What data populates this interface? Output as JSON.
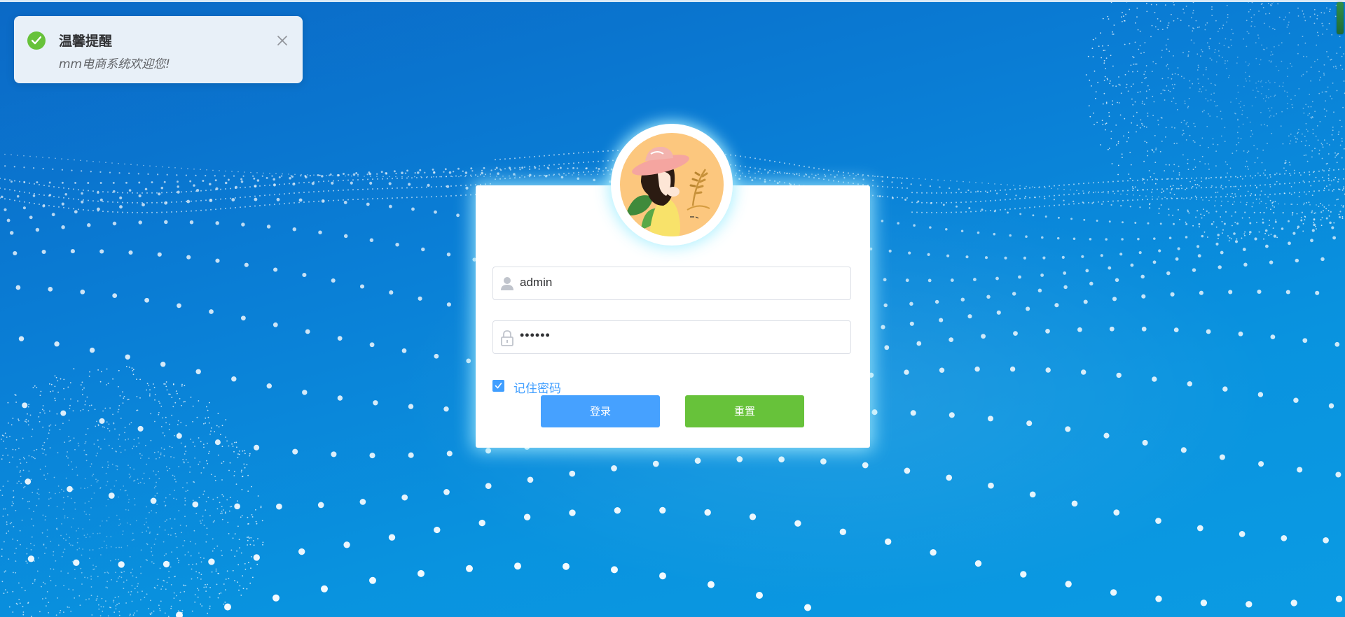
{
  "notification": {
    "title": "温馨提醒",
    "message": "mm电商系统欢迎您!",
    "icon": "success-check-icon",
    "close_icon": "close-icon",
    "status_color": "#67c23a"
  },
  "login": {
    "username_value": "admin",
    "password_value": "••••••",
    "username_icon": "user-icon",
    "password_icon": "lock-icon",
    "remember_label": "记住密码",
    "remember_checked": true,
    "login_button": "登录",
    "reset_button": "重置"
  },
  "colors": {
    "primary": "#409eff",
    "success": "#67c23a",
    "background": "#0a7fd6"
  }
}
